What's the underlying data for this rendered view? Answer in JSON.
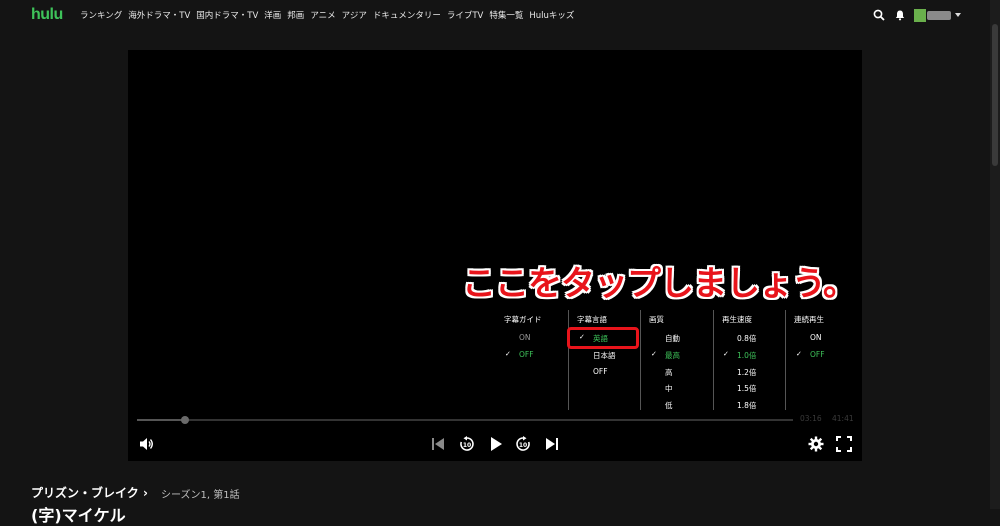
{
  "header": {
    "logo": "hulu",
    "nav": [
      "ランキング",
      "海外ドラマ・TV",
      "国内ドラマ・TV",
      "洋画",
      "邦画",
      "アニメ",
      "アジア",
      "ドキュメンタリー",
      "ライブTV",
      "特集一覧",
      "Huluキッズ"
    ],
    "icons": [
      "search-icon",
      "bell-icon",
      "avatar",
      "chevron-down-icon"
    ]
  },
  "player": {
    "callout": "ここをタップしましょう。",
    "settings": {
      "subtitle_guide": {
        "label": "字幕ガイド",
        "options": [
          "ON",
          "OFF"
        ],
        "selected": "OFF"
      },
      "subtitle_language": {
        "label": "字幕言語",
        "options": [
          "英語",
          "日本語",
          "OFF"
        ],
        "selected": "英語"
      },
      "quality": {
        "label": "画質",
        "options": [
          "自動",
          "最高",
          "高",
          "中",
          "低"
        ],
        "selected": "最高"
      },
      "speed": {
        "label": "再生速度",
        "options": [
          "0.8倍",
          "1.0倍",
          "1.2倍",
          "1.5倍",
          "1.8倍"
        ],
        "selected": "1.0倍"
      },
      "autoplay": {
        "label": "連続再生",
        "options": [
          "ON",
          "OFF"
        ],
        "selected": "OFF"
      }
    },
    "time_elapsed": "03:16",
    "time_total": "41:41",
    "progress": 0.073,
    "colors": {
      "accent": "#3ec35a",
      "callout": "#e8141b"
    }
  },
  "below": {
    "show_title": "プリズン・ブレイク",
    "season_episode": "シーズン1, 第1話",
    "episode_title": "(字)マイケル"
  }
}
